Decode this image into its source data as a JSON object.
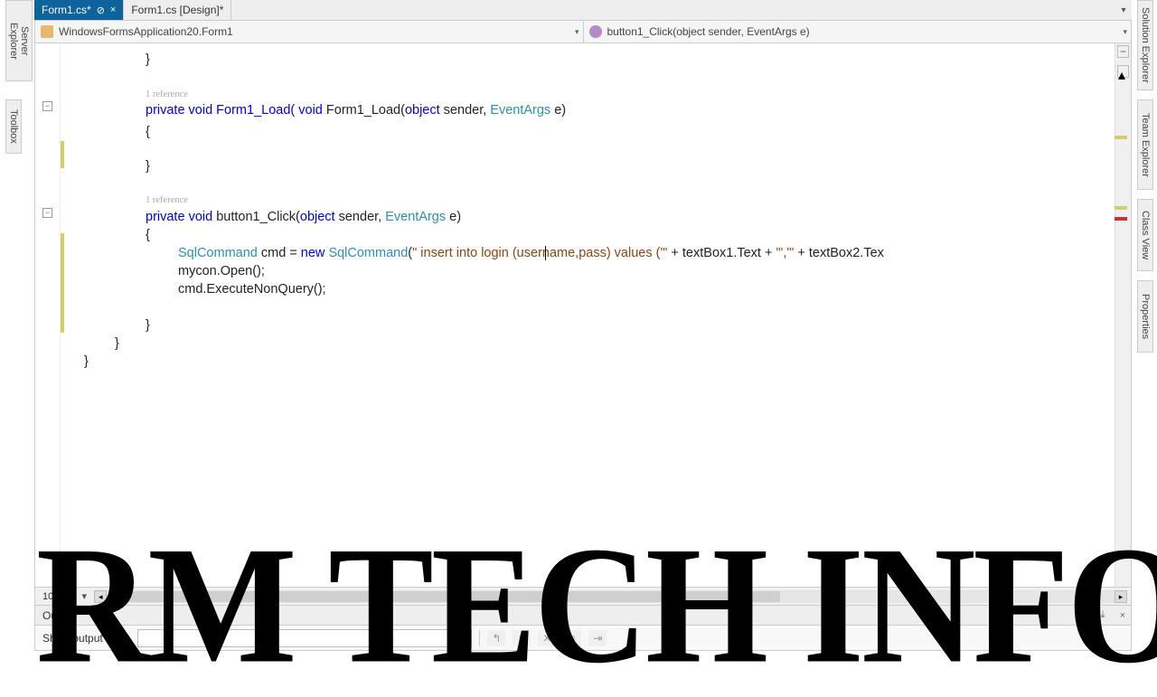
{
  "sidebarLeft": {
    "serverExplorer": "Server Explorer",
    "toolbox": "Toolbox"
  },
  "sidebarRight": {
    "solutionExplorer": "Solution Explorer",
    "teamExplorer": "Team Explorer",
    "classView": "Class View",
    "properties": "Properties"
  },
  "tabs": {
    "active": "Form1.cs*",
    "close": "×",
    "second": "Form1.cs [Design]*"
  },
  "nav": {
    "class": "WindowsFormsApplication20.Form1",
    "method": "button1_Click(object sender, EventArgs e)"
  },
  "zoom": {
    "value": "100 %"
  },
  "output": {
    "title": "Output",
    "label": "Show output from:"
  },
  "code": {
    "ref": "1 reference",
    "formLoad_pre": "private void Form1_Load(",
    "obj": "object",
    "sender": " sender, ",
    "evt": "EventArgs",
    "e_close": " e)",
    "btn_pre": "private void button1_Click(",
    "sqlType": "SqlCommand",
    "cmd_mid": " cmd = ",
    "new": "new",
    "sp": " ",
    "sqlCtor": "SqlCommand",
    "p1": "(",
    "str1": "\" insert into login (username,pass) values ('\"",
    "plus1": " + textBox1.Text + ",
    "str2": "\"','\"",
    "plus2": " + textBox2.Tex",
    "open": "mycon.Open();",
    "exec": "cmd.ExecuteNonQuery();",
    "lb": "{",
    "rb": "}"
  },
  "watermark": "RM TECH INFO"
}
